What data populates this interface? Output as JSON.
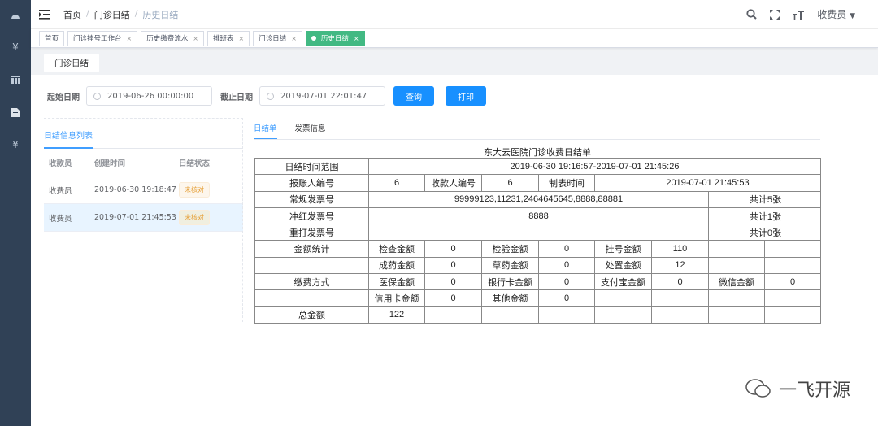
{
  "sidebar": {
    "items": [
      {
        "icon": "dashboard-icon"
      },
      {
        "icon": "yen-icon"
      },
      {
        "icon": "table-icon"
      },
      {
        "icon": "document-icon"
      },
      {
        "icon": "yen-icon"
      }
    ]
  },
  "header": {
    "breadcrumb": [
      "首页",
      "门诊日结",
      "历史日结"
    ],
    "user": "收费员"
  },
  "tags": [
    {
      "label": "首页",
      "closable": false
    },
    {
      "label": "门诊挂号工作台",
      "closable": true
    },
    {
      "label": "历史缴费流水",
      "closable": true
    },
    {
      "label": "排班表",
      "closable": true
    },
    {
      "label": "门诊日结",
      "closable": true
    },
    {
      "label": "历史日结",
      "closable": true,
      "active": true
    }
  ],
  "page_tab": "门诊日结",
  "filter": {
    "start_label": "起始日期",
    "start_value": "2019-06-26 00:00:00",
    "end_label": "截止日期",
    "end_value": "2019-07-01 22:01:47",
    "query": "查询",
    "print": "打印"
  },
  "list": {
    "title": "日结信息列表",
    "columns": [
      "收款员",
      "创建时间",
      "日结状态"
    ],
    "rows": [
      {
        "cashier": "收费员",
        "time": "2019-06-30 19:18:47",
        "status": "未核对"
      },
      {
        "cashier": "收费员",
        "time": "2019-07-01 21:45:53",
        "status": "未核对",
        "selected": true
      }
    ]
  },
  "right_tabs": [
    "日结单",
    "发票信息"
  ],
  "sheet": {
    "title": "东大云医院门诊收费日结单",
    "rows": [
      [
        [
          "日结时间范围",
          1
        ],
        [
          "2019-06-30 19:16:57-2019-07-01 21:45:26",
          8
        ]
      ],
      [
        [
          "报账人编号",
          1
        ],
        [
          "6",
          1
        ],
        [
          "收款人编号",
          1
        ],
        [
          "6",
          1
        ],
        [
          "制表时间",
          1
        ],
        [
          "2019-07-01 21:45:53",
          4
        ]
      ],
      [
        [
          "常规发票号",
          1
        ],
        [
          "99999123,11231,2464645645,8888,88881",
          6
        ],
        [
          "共计5张",
          2
        ]
      ],
      [
        [
          "冲红发票号",
          1
        ],
        [
          "8888",
          6
        ],
        [
          "共计1张",
          2
        ]
      ],
      [
        [
          "重打发票号",
          1
        ],
        [
          "",
          6
        ],
        [
          "共计0张",
          2
        ]
      ],
      [
        [
          "金额统计",
          1
        ],
        [
          "检查金额",
          1
        ],
        [
          "0",
          1
        ],
        [
          "检验金额",
          1
        ],
        [
          "0",
          1
        ],
        [
          "挂号金额",
          1
        ],
        [
          "110",
          1
        ],
        [
          "",
          1
        ],
        [
          "",
          1
        ]
      ],
      [
        [
          "",
          1
        ],
        [
          "成药金额",
          1
        ],
        [
          "0",
          1
        ],
        [
          "草药金额",
          1
        ],
        [
          "0",
          1
        ],
        [
          "处置金额",
          1
        ],
        [
          "12",
          1
        ],
        [
          "",
          1
        ],
        [
          "",
          1
        ]
      ],
      [
        [
          "缴费方式",
          1
        ],
        [
          "医保金额",
          1
        ],
        [
          "0",
          1
        ],
        [
          "银行卡金额",
          1
        ],
        [
          "0",
          1
        ],
        [
          "支付宝金额",
          1
        ],
        [
          "0",
          1
        ],
        [
          "微信金额",
          1
        ],
        [
          "0",
          1
        ]
      ],
      [
        [
          "",
          1
        ],
        [
          "信用卡金额",
          1
        ],
        [
          "0",
          1
        ],
        [
          "其他金额",
          1
        ],
        [
          "0",
          1
        ],
        [
          "",
          1
        ],
        [
          "",
          1
        ],
        [
          "",
          1
        ],
        [
          "",
          1
        ]
      ],
      [
        [
          "总金额",
          1
        ],
        [
          "122",
          1
        ],
        [
          "",
          1
        ],
        [
          "",
          1
        ],
        [
          "",
          1
        ],
        [
          "",
          1
        ],
        [
          "",
          1
        ],
        [
          "",
          1
        ],
        [
          "",
          1
        ]
      ]
    ]
  },
  "watermark": "一飞开源"
}
